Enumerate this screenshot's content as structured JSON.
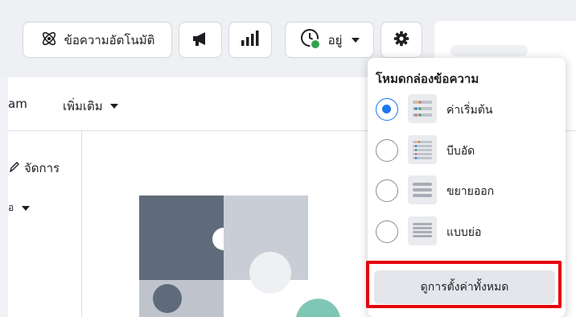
{
  "toolbar": {
    "auto_message_label": "ข้อความอัตโนมัติ",
    "status_label": "อยู่",
    "icons": {
      "auto_message": "atom-icon",
      "announce": "megaphone-icon",
      "insights": "bar-chart-icon",
      "status": "clock-status-icon",
      "settings": "gear-icon"
    }
  },
  "tabs": {
    "partial_label": "am",
    "more_label": "เพิ่มเติม"
  },
  "left_panel": {
    "manage_label": "จัดการ",
    "dropdown_label": "อ"
  },
  "popup": {
    "title": "โหมดกล่องข้อความ",
    "options": [
      {
        "label": "ค่าเริ่มต้น",
        "selected": true,
        "icon": "default-layout-icon"
      },
      {
        "label": "บีบอัด",
        "selected": false,
        "icon": "compressed-layout-icon"
      },
      {
        "label": "ขยายออก",
        "selected": false,
        "icon": "expanded-layout-icon"
      },
      {
        "label": "แบบย่อ",
        "selected": false,
        "icon": "compact-layout-icon"
      }
    ],
    "view_all_label": "ดูการตั้งค่าทั้งหมด"
  },
  "colors": {
    "accent": "#1877f2",
    "highlight": "#e4000c",
    "status_online": "#31a24c"
  }
}
